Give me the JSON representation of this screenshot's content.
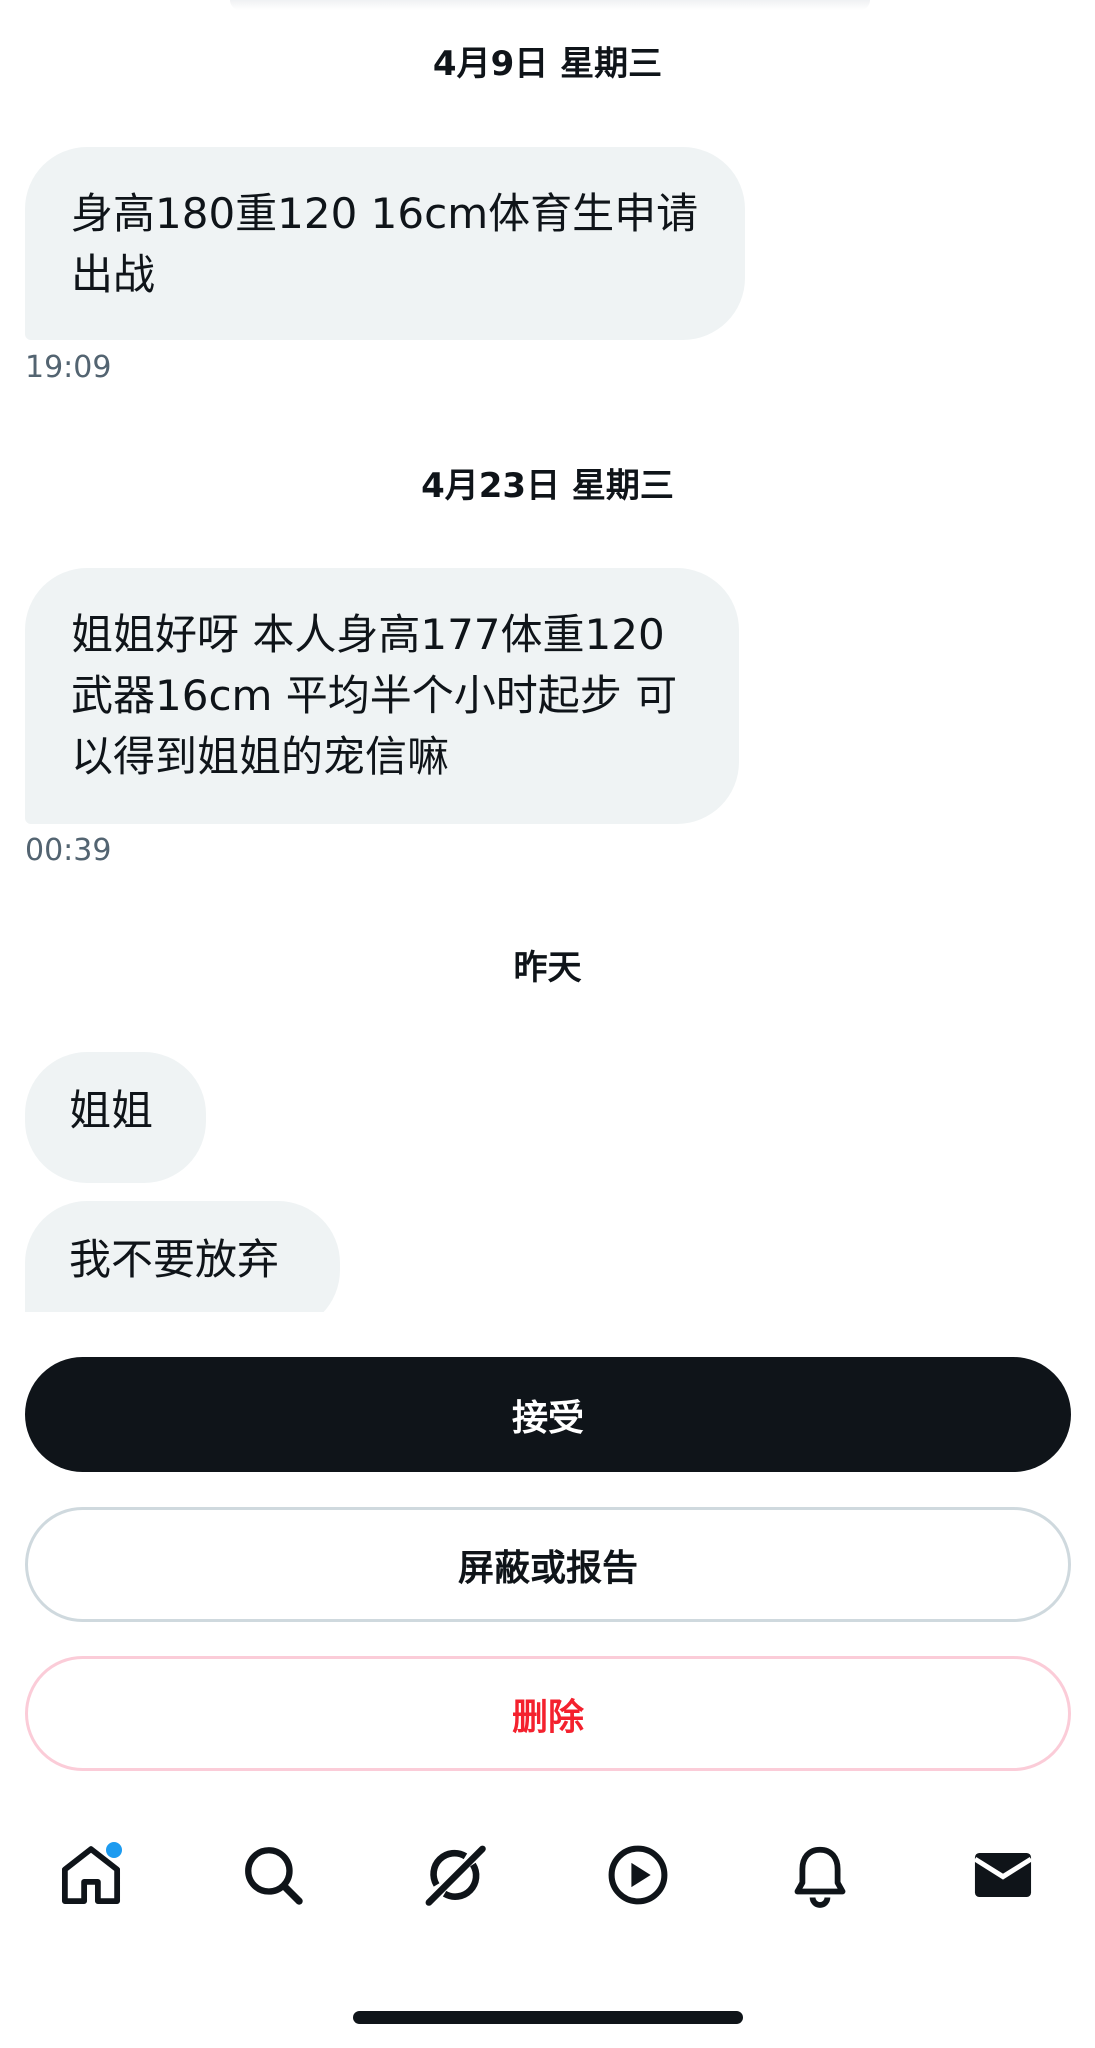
{
  "conversation": {
    "groups": [
      {
        "date": "4月9日 星期三",
        "messages": [
          {
            "text": "身高180重120 16cm体育生申请出战",
            "time": "19:09"
          }
        ]
      },
      {
        "date": "4月23日 星期三",
        "messages": [
          {
            "text": "姐姐好呀 本人身高177体重120 武器16cm 平均半个小时起步 可以得到姐姐的宠信嘛",
            "time": "00:39"
          }
        ]
      },
      {
        "date": "昨天",
        "messages": [
          {
            "text": "姐姐"
          },
          {
            "text": "我不要放弃"
          }
        ]
      }
    ]
  },
  "actions": {
    "accept_label": "接受",
    "block_report_label": "屏蔽或报告",
    "delete_label": "删除"
  },
  "tab_bar": {
    "items": [
      "home-icon",
      "search-icon",
      "grok-icon",
      "play-icon",
      "bell-icon",
      "mail-icon"
    ],
    "home_has_notification": true,
    "active": "mail-icon"
  },
  "colors": {
    "bubble": "#eff3f4",
    "accept": "#0f1419",
    "delete_text": "#f4212e",
    "notification_dot": "#1d9bf0"
  }
}
